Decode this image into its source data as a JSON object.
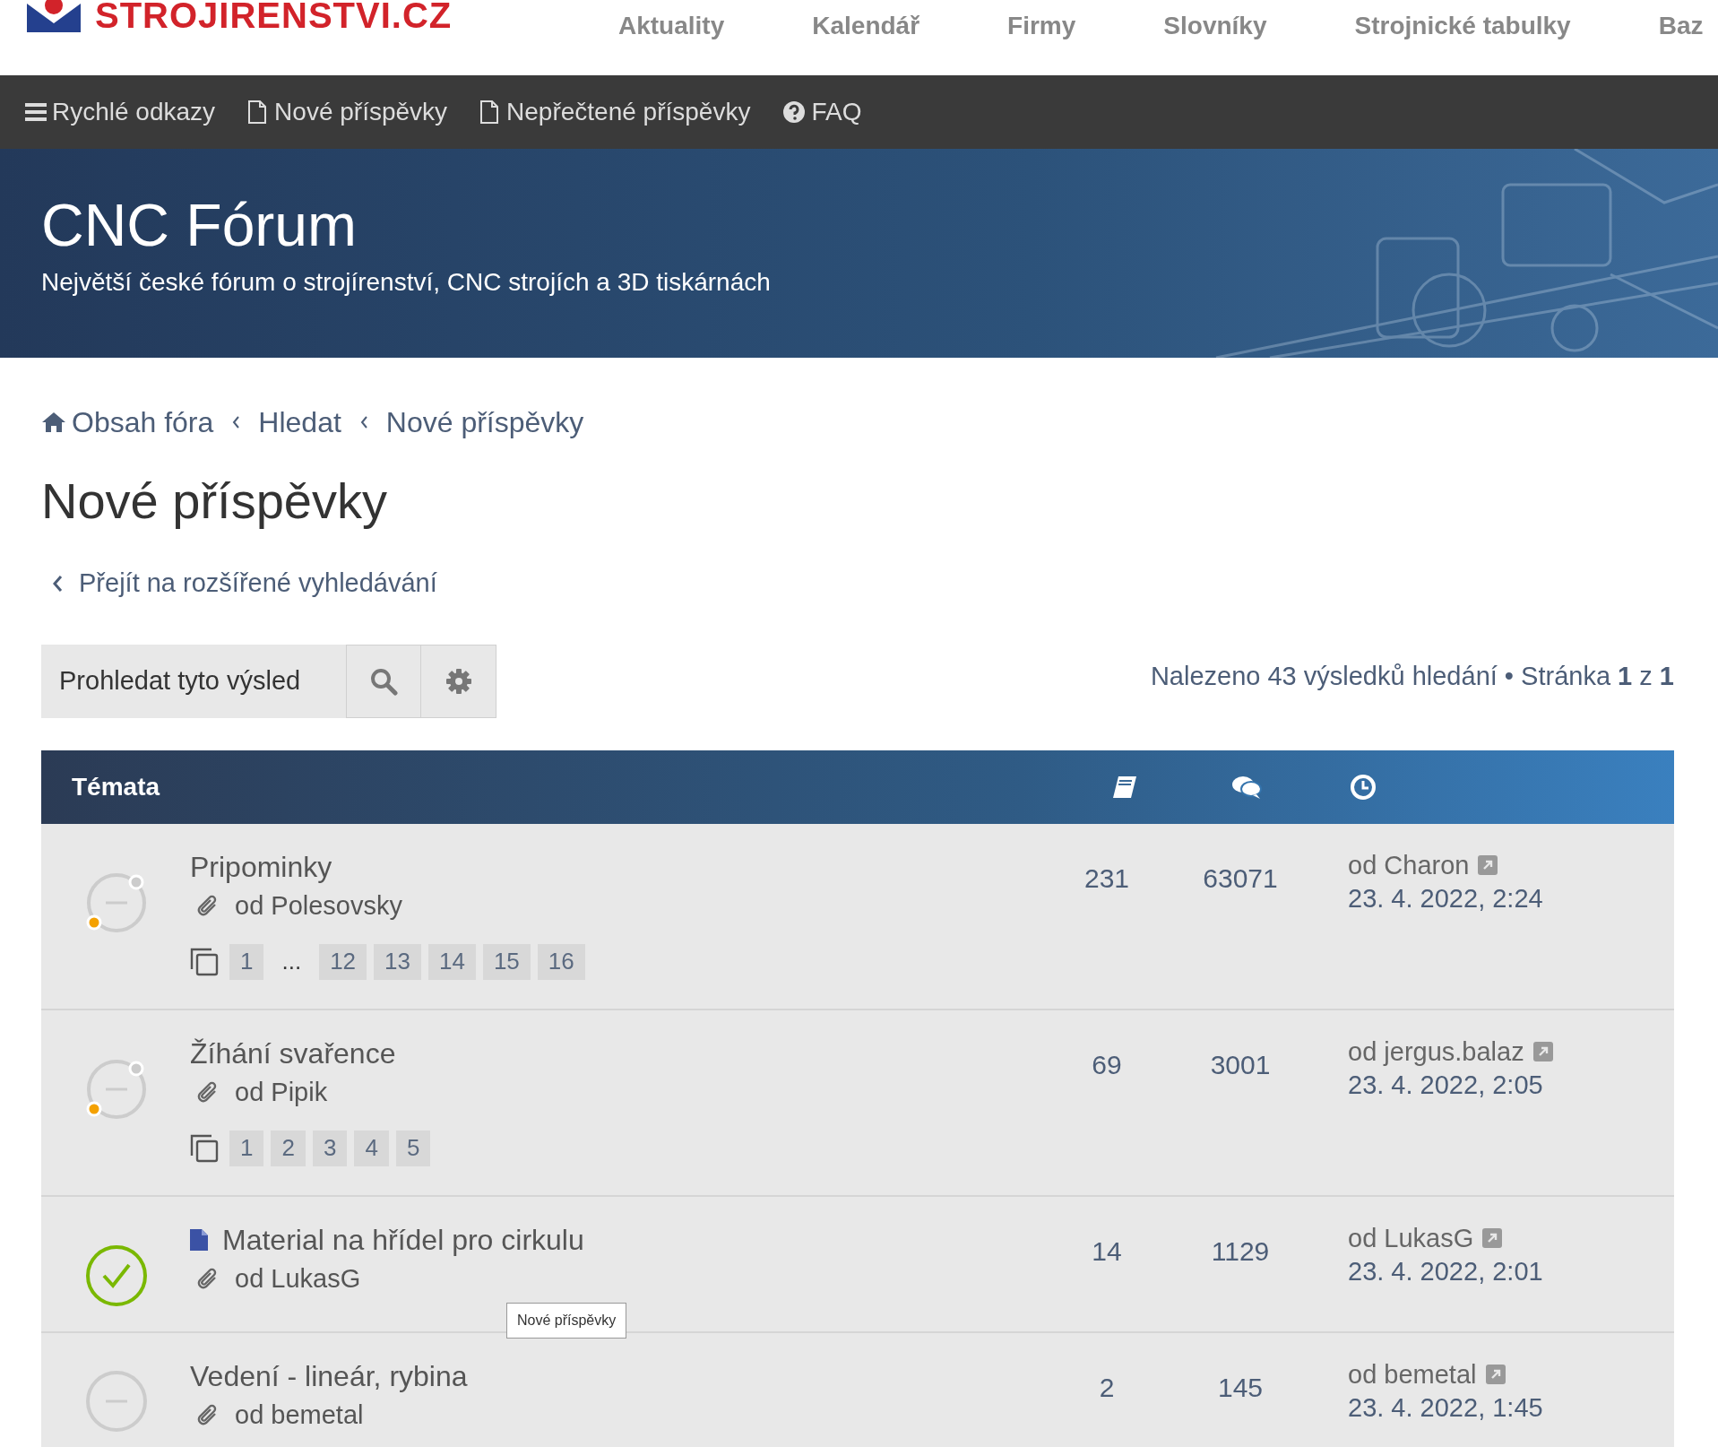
{
  "header": {
    "logo_text": "STROJIRENSTVI.CZ",
    "nav": [
      "Aktuality",
      "Kalendář",
      "Firmy",
      "Slovníky",
      "Strojnické tabulky",
      "Baz"
    ]
  },
  "quick_bar": [
    {
      "kind": "menu",
      "label": "Rychlé odkazy"
    },
    {
      "kind": "file",
      "label": "Nové příspěvky"
    },
    {
      "kind": "file",
      "label": "Nepřečtené příspěvky"
    },
    {
      "kind": "help",
      "label": "FAQ"
    }
  ],
  "hero": {
    "title": "CNC Fórum",
    "subtitle": "Největší české fórum o strojírenství, CNC strojích a 3D tiskárnách"
  },
  "breadcrumbs": [
    "Obsah fóra",
    "Hledat",
    "Nové příspěvky"
  ],
  "page_title": "Nové příspěvky",
  "advanced_search_link": "Přejít na rozšířené vyhledávání",
  "search": {
    "placeholder": "Prohledat tyto výsled"
  },
  "result_info": "Nalezeno 43 výsledků hledání • Stránka **1** z **1**",
  "table": {
    "header": "Témata",
    "topics": [
      {
        "kind": "hot",
        "new_post": false,
        "title": "Pripominky",
        "author": "od Polesovsky",
        "pages": [
          "1",
          "...",
          "12",
          "13",
          "14",
          "15",
          "16"
        ],
        "replies": "231",
        "views": "63071",
        "last_by": "od Charon",
        "last_time": "23. 4. 2022, 2:24"
      },
      {
        "kind": "hot",
        "new_post": false,
        "title": "Žíhání svařence",
        "author": "od Pipik",
        "pages": [
          "1",
          "2",
          "3",
          "4",
          "5"
        ],
        "replies": "69",
        "views": "3001",
        "last_by": "od jergus.balaz",
        "last_time": "23. 4. 2022, 2:05"
      },
      {
        "kind": "solved",
        "new_post": true,
        "title": "Material na hřídel pro cirkulu",
        "author": "od LukasG",
        "replies": "14",
        "views": "1129",
        "last_by": "od LukasG",
        "last_time": "23. 4. 2022, 2:01"
      },
      {
        "kind": "read",
        "new_post": false,
        "title": "Vedení - lineár, rybina",
        "author": "od bemetal",
        "replies": "2",
        "views": "145",
        "last_by": "od bemetal",
        "last_time": "23. 4. 2022, 1:45"
      }
    ]
  },
  "tooltip": "Nové příspěvky"
}
